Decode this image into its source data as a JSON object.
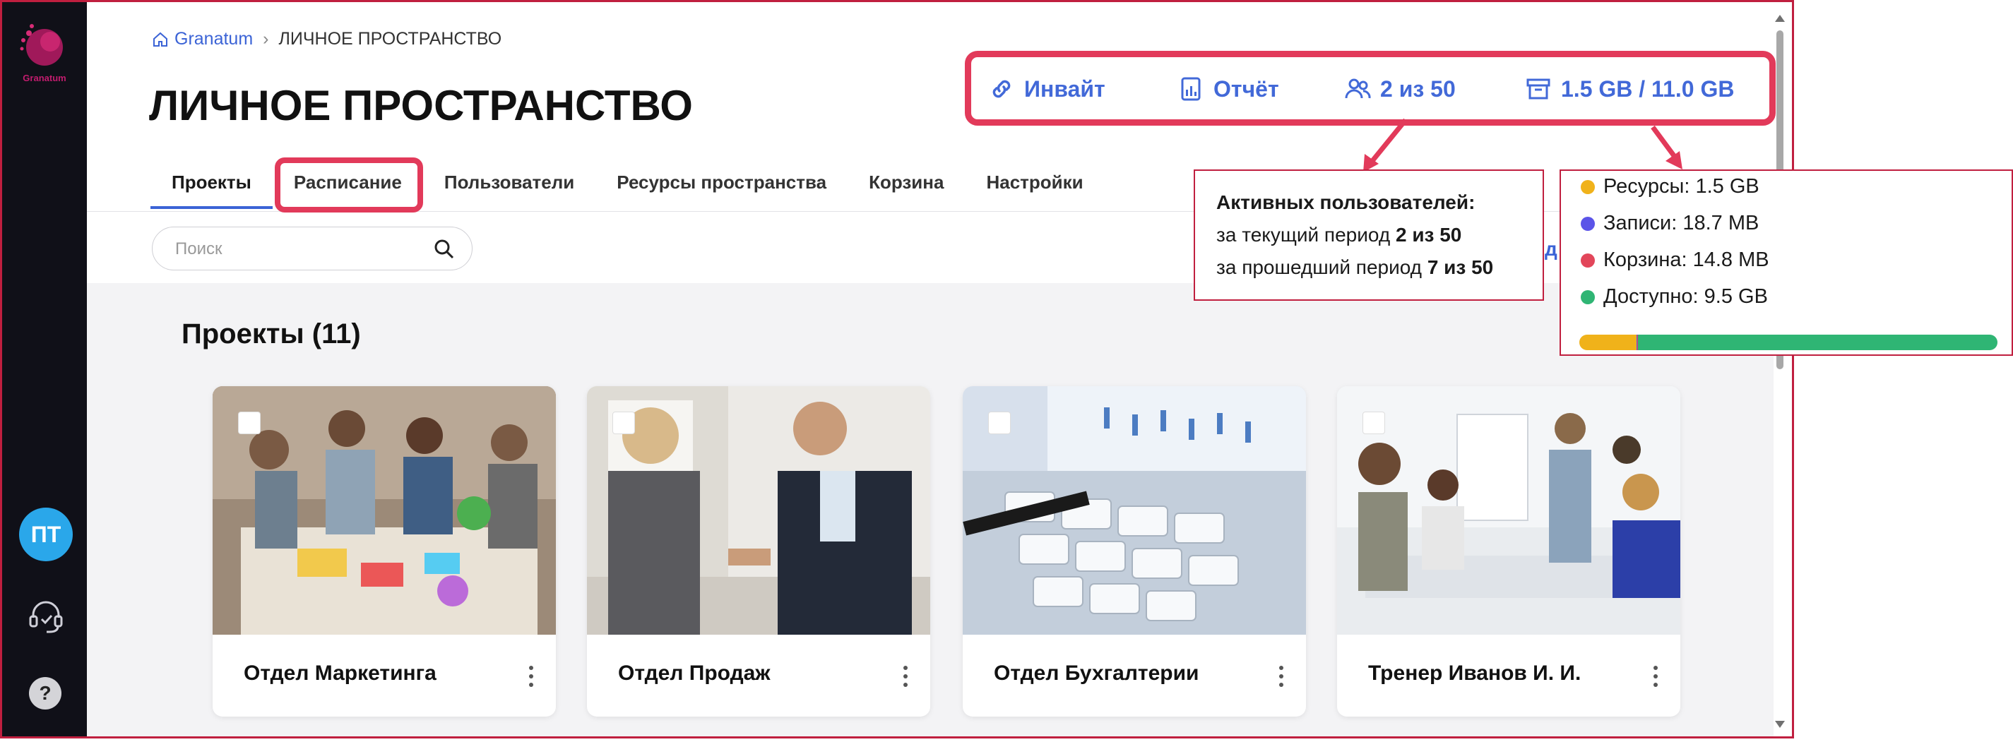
{
  "app": {
    "logo_text": "Granatum",
    "user_initials": "ПТ",
    "help_glyph": "?"
  },
  "breadcrumb": {
    "home": "Granatum",
    "separator": "›",
    "current": "ЛИЧНОЕ ПРОСТРАНСТВО"
  },
  "page_title": "ЛИЧНОЕ ПРОСТРАНСТВО",
  "toolbar": {
    "invite": "Инвайт",
    "report": "Отчёт",
    "users": "2 из 50",
    "storage": "1.5 GB / 11.0 GB"
  },
  "tabs": [
    {
      "label": "Проекты",
      "active": true
    },
    {
      "label": "Расписание",
      "highlighted": true
    },
    {
      "label": "Пользователи"
    },
    {
      "label": "Ресурсы пространства"
    },
    {
      "label": "Корзина"
    },
    {
      "label": "Настройки"
    }
  ],
  "search": {
    "placeholder": "Поиск"
  },
  "section_title": "Проекты (11)",
  "peek_text": "д",
  "projects": [
    {
      "title": "Отдел Маркетинга"
    },
    {
      "title": "Отдел Продаж"
    },
    {
      "title": "Отдел Бухгалтерии"
    },
    {
      "title": "Тренер Иванов И. И."
    }
  ],
  "users_tooltip": {
    "heading": "Активных пользователей:",
    "current_prefix": "за текущий период",
    "current_value": "2 из 50",
    "past_prefix": "за прошедший период",
    "past_value": "7 из 50"
  },
  "storage_tooltip": {
    "items": [
      {
        "label": "Ресурсы: 1.5 GB",
        "color": "#f0b21a"
      },
      {
        "label": "Записи: 18.7 MB",
        "color": "#5b54e8"
      },
      {
        "label": "Корзина: 14.8 MB",
        "color": "#e2465a"
      },
      {
        "label": "Доступно: 9.5 GB",
        "color": "#2fb574"
      }
    ],
    "bar_fractions": {
      "resources": 0.137,
      "records": 0.0017,
      "trash": 0.0013,
      "available": 0.86
    }
  },
  "colors": {
    "accent": "#3b63d6",
    "highlight": "#e23a5a",
    "sidebar": "#101018"
  }
}
